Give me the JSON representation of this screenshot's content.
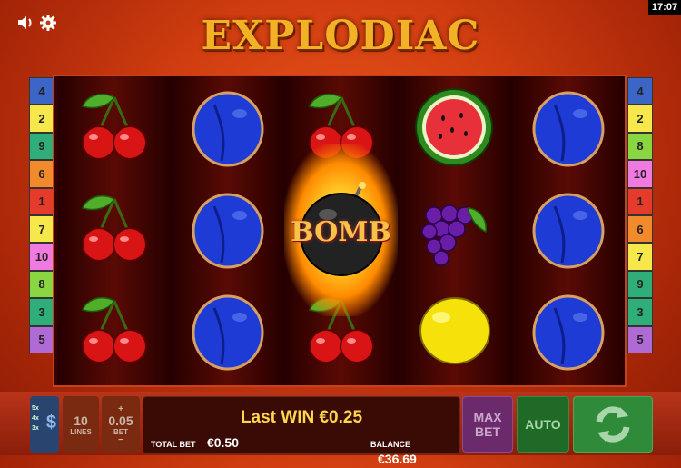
{
  "header": {
    "title": "EXPLODIAC",
    "clock": "17:07"
  },
  "paylines_left": [
    {
      "label": "4",
      "color": "#3b66c7"
    },
    {
      "label": "2",
      "color": "#f6e84a"
    },
    {
      "label": "9",
      "color": "#2fae7a"
    },
    {
      "label": "6",
      "color": "#f08a2a"
    },
    {
      "label": "1",
      "color": "#e63a2a"
    },
    {
      "label": "7",
      "color": "#f6e84a"
    },
    {
      "label": "10",
      "color": "#f07adf"
    },
    {
      "label": "8",
      "color": "#8ad640"
    },
    {
      "label": "3",
      "color": "#2fae7a"
    },
    {
      "label": "5",
      "color": "#b06ad6"
    }
  ],
  "paylines_right": [
    {
      "label": "4",
      "color": "#3b66c7"
    },
    {
      "label": "2",
      "color": "#f6e84a"
    },
    {
      "label": "8",
      "color": "#8ad640"
    },
    {
      "label": "10",
      "color": "#f07adf"
    },
    {
      "label": "1",
      "color": "#e63a2a"
    },
    {
      "label": "6",
      "color": "#f08a2a"
    },
    {
      "label": "7",
      "color": "#f6e84a"
    },
    {
      "label": "9",
      "color": "#2fae7a"
    },
    {
      "label": "3",
      "color": "#2fae7a"
    },
    {
      "label": "5",
      "color": "#b06ad6"
    }
  ],
  "reels": [
    [
      "cherry",
      "cherry",
      "cherry"
    ],
    [
      "plum",
      "plum",
      "plum"
    ],
    [
      "cherry",
      "bomb",
      "cherry"
    ],
    [
      "watermelon",
      "grapes",
      "lemon"
    ],
    [
      "plum",
      "plum",
      "plum"
    ]
  ],
  "bomb_text": "BOMB",
  "controls": {
    "currency_options": [
      "5x",
      "4x",
      "3x"
    ],
    "currency_symbol": "$",
    "lines_value": "10",
    "lines_label": "LINES",
    "bet_plus": "+",
    "bet_value": "0.05",
    "bet_label": "BET",
    "bet_minus": "−",
    "last_win": "Last WIN €0.25",
    "total_bet_label": "TOTAL BET",
    "total_bet_value": "€0.50",
    "balance_label": "BALANCE",
    "balance_value": "€36.69",
    "max_bet_line1": "MAX",
    "max_bet_line2": "BET",
    "auto_label": "AUTO"
  },
  "colors": {
    "maxbet": "#6b2a6b",
    "auto": "#1f6a26",
    "spin": "#2f8a3a"
  }
}
